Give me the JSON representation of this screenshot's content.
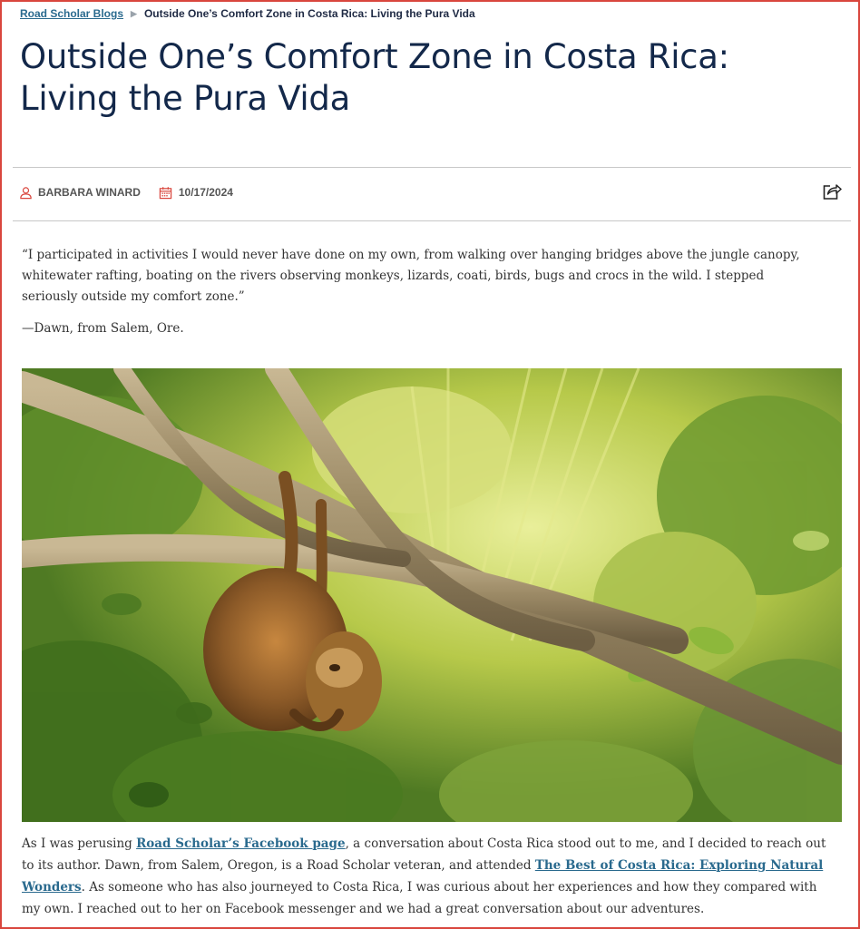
{
  "breadcrumb": {
    "parent": "Road Scholar Blogs",
    "current": "Outside One’s Comfort Zone in Costa Rica: Living the Pura Vida"
  },
  "article": {
    "title": "Outside One’s Comfort Zone in Costa Rica: Living the Pura Vida",
    "author": "BARBARA WINARD",
    "date": "10/17/2024",
    "quote": "“I participated in activities I would never have done on my own, from walking over hanging bridges above the jungle canopy, whitewater rafting, boating on the rivers observing monkeys, lizards, coati, birds, bugs and crocs in the wild. I stepped seriously outside my comfort zone.”",
    "attribution": "—Dawn, from Salem, Ore.",
    "body": {
      "p1_a": "As I was perusing ",
      "link1": "Road Scholar’s Facebook page",
      "p1_b": ", a conversation about Costa Rica stood out to me, and I decided to reach out to its author. Dawn, from Salem, Oregon, is a Road Scholar veteran, and attended ",
      "link2": "The Best of Costa Rica: Exploring Natural Wonders",
      "p1_c": ". As someone who has also journeyed to Costa Rica, I was curious about her experiences and how they compared with my own. I reached out to her on Facebook messenger and we had a great conversation about our adventures."
    }
  },
  "icons": {
    "author": "user-icon",
    "date": "calendar-icon",
    "share": "share-icon"
  },
  "colors": {
    "frame_border": "#d9463d",
    "title": "#13284a",
    "link": "#2a6a8e",
    "meta_icon": "#d9463d"
  }
}
